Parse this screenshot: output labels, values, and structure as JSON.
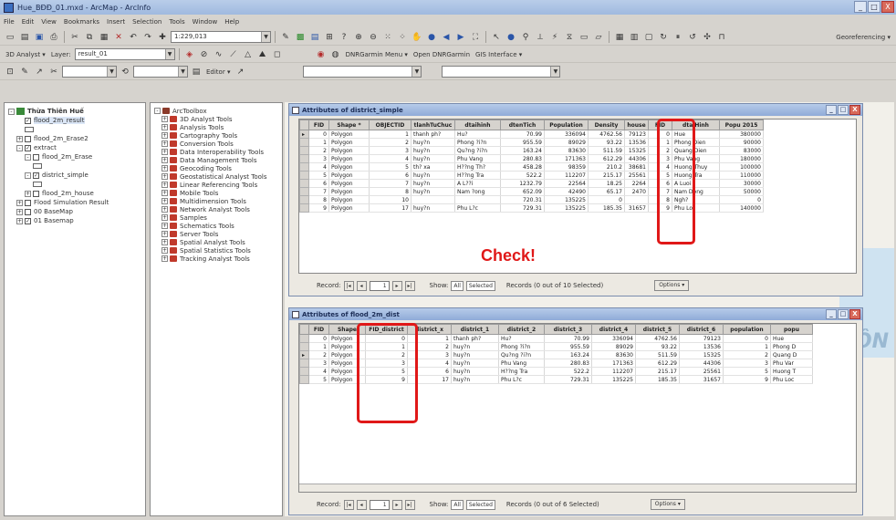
{
  "window": {
    "title": "Hue_BĐĐ_01.mxd - ArcMap - ArcInfo",
    "min": "_",
    "max": "□",
    "close": "X"
  },
  "menu": [
    "File",
    "Edit",
    "View",
    "Bookmarks",
    "Insert",
    "Selection",
    "Tools",
    "Window",
    "Help"
  ],
  "toolbar": {
    "scale": "1:229,013",
    "georef_label": "Georeferencing ▾",
    "layer_label": "Layer:",
    "layer_value": "result_01",
    "analyst_label": "3D Analyst ▾",
    "editor_label": "Editor ▾",
    "dnr_label": "DNRGarmin Menu ▾",
    "dnr2_label": "Open DNRGarmin",
    "gis_label": "GIS Interface ▾"
  },
  "toc": {
    "items": [
      {
        "text": "Thừa Thiên Huế",
        "level": 0,
        "pm": "-",
        "cb": "",
        "bold": true
      },
      {
        "text": "flood_2m_result",
        "level": 1,
        "pm": "",
        "cb": "✓",
        "hl": true
      },
      {
        "text": "",
        "level": 2,
        "pm": "",
        "cb": "",
        "sw": true
      },
      {
        "text": "flood_2m_Erase2",
        "level": 1,
        "pm": "+",
        "cb": ""
      },
      {
        "text": "extract",
        "level": 1,
        "pm": "-",
        "cb": "✓"
      },
      {
        "text": "flood_2m_Erase",
        "level": 2,
        "pm": "-",
        "cb": ""
      },
      {
        "text": "",
        "level": 3,
        "pm": "",
        "cb": "",
        "sw": true
      },
      {
        "text": "district_simple",
        "level": 2,
        "pm": "-",
        "cb": "✓"
      },
      {
        "text": "",
        "level": 3,
        "pm": "",
        "cb": "",
        "sw": true
      },
      {
        "text": "flood_2m_house",
        "level": 2,
        "pm": "+",
        "cb": ""
      },
      {
        "text": "Flood Simulation Result",
        "level": 1,
        "pm": "+",
        "cb": ""
      },
      {
        "text": "00 BaseMap",
        "level": 1,
        "pm": "+",
        "cb": ""
      },
      {
        "text": "01 Basemap",
        "level": 1,
        "pm": "+",
        "cb": "✓"
      }
    ]
  },
  "toolbox": {
    "title": "ArcToolbox",
    "items": [
      "3D Analyst Tools",
      "Analysis Tools",
      "Cartography Tools",
      "Conversion Tools",
      "Data Interoperability Tools",
      "Data Management Tools",
      "Geocoding Tools",
      "Geostatistical Analyst Tools",
      "Linear Referencing Tools",
      "Mobile Tools",
      "Multidimension Tools",
      "Network Analyst Tools",
      "Samples",
      "Schematics Tools",
      "Server Tools",
      "Spatial Analyst Tools",
      "Spatial Statistics Tools",
      "Tracking Analyst Tools"
    ]
  },
  "table1": {
    "title": "Attributes of district_simple",
    "columns": [
      "FID",
      "Shape *",
      "OBJECTID",
      "tlanhTuChuc",
      "dtaihinh",
      "dtenTich",
      "Population",
      "Density",
      "house",
      "FID",
      "dtaiHinh",
      "Popu 2015"
    ],
    "rows": [
      [
        "0",
        "Polygon",
        "1",
        "thanh ph?",
        "Hu?",
        "70.99",
        "336094",
        "4762.56",
        "79123",
        "0",
        "Hue",
        "380000"
      ],
      [
        "1",
        "Polygon",
        "2",
        "huy?n",
        "Phong ?i?n",
        "955.59",
        "89029",
        "93.22",
        "13536",
        "1",
        "Phong Dien",
        "90000"
      ],
      [
        "2",
        "Polygon",
        "3",
        "huy?n",
        "Qu?ng ?i?n",
        "163.24",
        "83630",
        "511.59",
        "15325",
        "2",
        "Quang Dien",
        "83000"
      ],
      [
        "3",
        "Polygon",
        "4",
        "huy?n",
        "Phu Vang",
        "280.83",
        "171363",
        "612.29",
        "44306",
        "3",
        "Phu Vang",
        "180000"
      ],
      [
        "4",
        "Polygon",
        "5",
        "th? xa",
        "H??ng Th?",
        "458.28",
        "98359",
        "210.2",
        "38681",
        "4",
        "Huong Thuy",
        "100000"
      ],
      [
        "5",
        "Polygon",
        "6",
        "huy?n",
        "H??ng Tra",
        "522.2",
        "112207",
        "215.17",
        "25561",
        "5",
        "Huong Tra",
        "110000"
      ],
      [
        "6",
        "Polygon",
        "7",
        "huy?n",
        "A L??i",
        "1232.79",
        "22564",
        "18.25",
        "2264",
        "6",
        "A Luoi",
        "30000"
      ],
      [
        "7",
        "Polygon",
        "8",
        "huy?n",
        "Nam ?ong",
        "652.09",
        "42490",
        "65.17",
        "2470",
        "7",
        "Nam Dong",
        "50000"
      ],
      [
        "8",
        "Polygon",
        "10",
        "",
        "",
        "720.31",
        "135225",
        "0",
        "",
        "8",
        "Ngh?",
        "0"
      ],
      [
        "9",
        "Polygon",
        "17",
        "huy?n",
        "Phu L?c",
        "729.31",
        "135225",
        "185.35",
        "31657",
        "9",
        "Phu Loc",
        "140000"
      ]
    ],
    "nav": {
      "record_label": "Record:",
      "record_value": "1",
      "show_label": "Show:",
      "all": "All",
      "selected": "Selected",
      "records_text": "Records (0 out of 10 Selected)",
      "options": "Options ▾"
    }
  },
  "table2": {
    "title": "Attributes of flood_2m_dist",
    "columns": [
      "FID",
      "Shape",
      "FID_district",
      "district_x",
      "district_1",
      "district_2",
      "district_3",
      "district_4",
      "district_5",
      "district_6",
      "population",
      "popu"
    ],
    "rows": [
      [
        "0",
        "Polygon",
        "0",
        "1",
        "thanh ph?",
        "Hu?",
        "70.99",
        "336094",
        "4762.56",
        "79123",
        "0",
        "Hue"
      ],
      [
        "1",
        "Polygon",
        "1",
        "2",
        "huy?n",
        "Phong ?i?n",
        "955.59",
        "89029",
        "93.22",
        "13536",
        "1",
        "Phong D"
      ],
      [
        "2",
        "Polygon",
        "2",
        "3",
        "huy?n",
        "Qu?ng ?i?n",
        "163.24",
        "83630",
        "511.59",
        "15325",
        "2",
        "Quang D"
      ],
      [
        "3",
        "Polygon",
        "3",
        "4",
        "huy?n",
        "Phu Vang",
        "280.83",
        "171363",
        "612.29",
        "44306",
        "3",
        "Phu Var"
      ],
      [
        "4",
        "Polygon",
        "5",
        "6",
        "huy?n",
        "H??ng Tra",
        "522.2",
        "112207",
        "215.17",
        "25561",
        "5",
        "Huong T"
      ],
      [
        "5",
        "Polygon",
        "9",
        "17",
        "huy?n",
        "Phu L?c",
        "729.31",
        "135225",
        "185.35",
        "31657",
        "9",
        "Phu Loc"
      ]
    ],
    "nav": {
      "record_label": "Record:",
      "record_value": "1",
      "show_label": "Show:",
      "all": "All",
      "selected": "Selected",
      "records_text": "Records (0 out of 6 Selected)",
      "options": "Options ▾"
    }
  },
  "annotation": {
    "text": "Check!",
    "color": "#e01818"
  },
  "map": {
    "water_label": "ĐÔN"
  }
}
